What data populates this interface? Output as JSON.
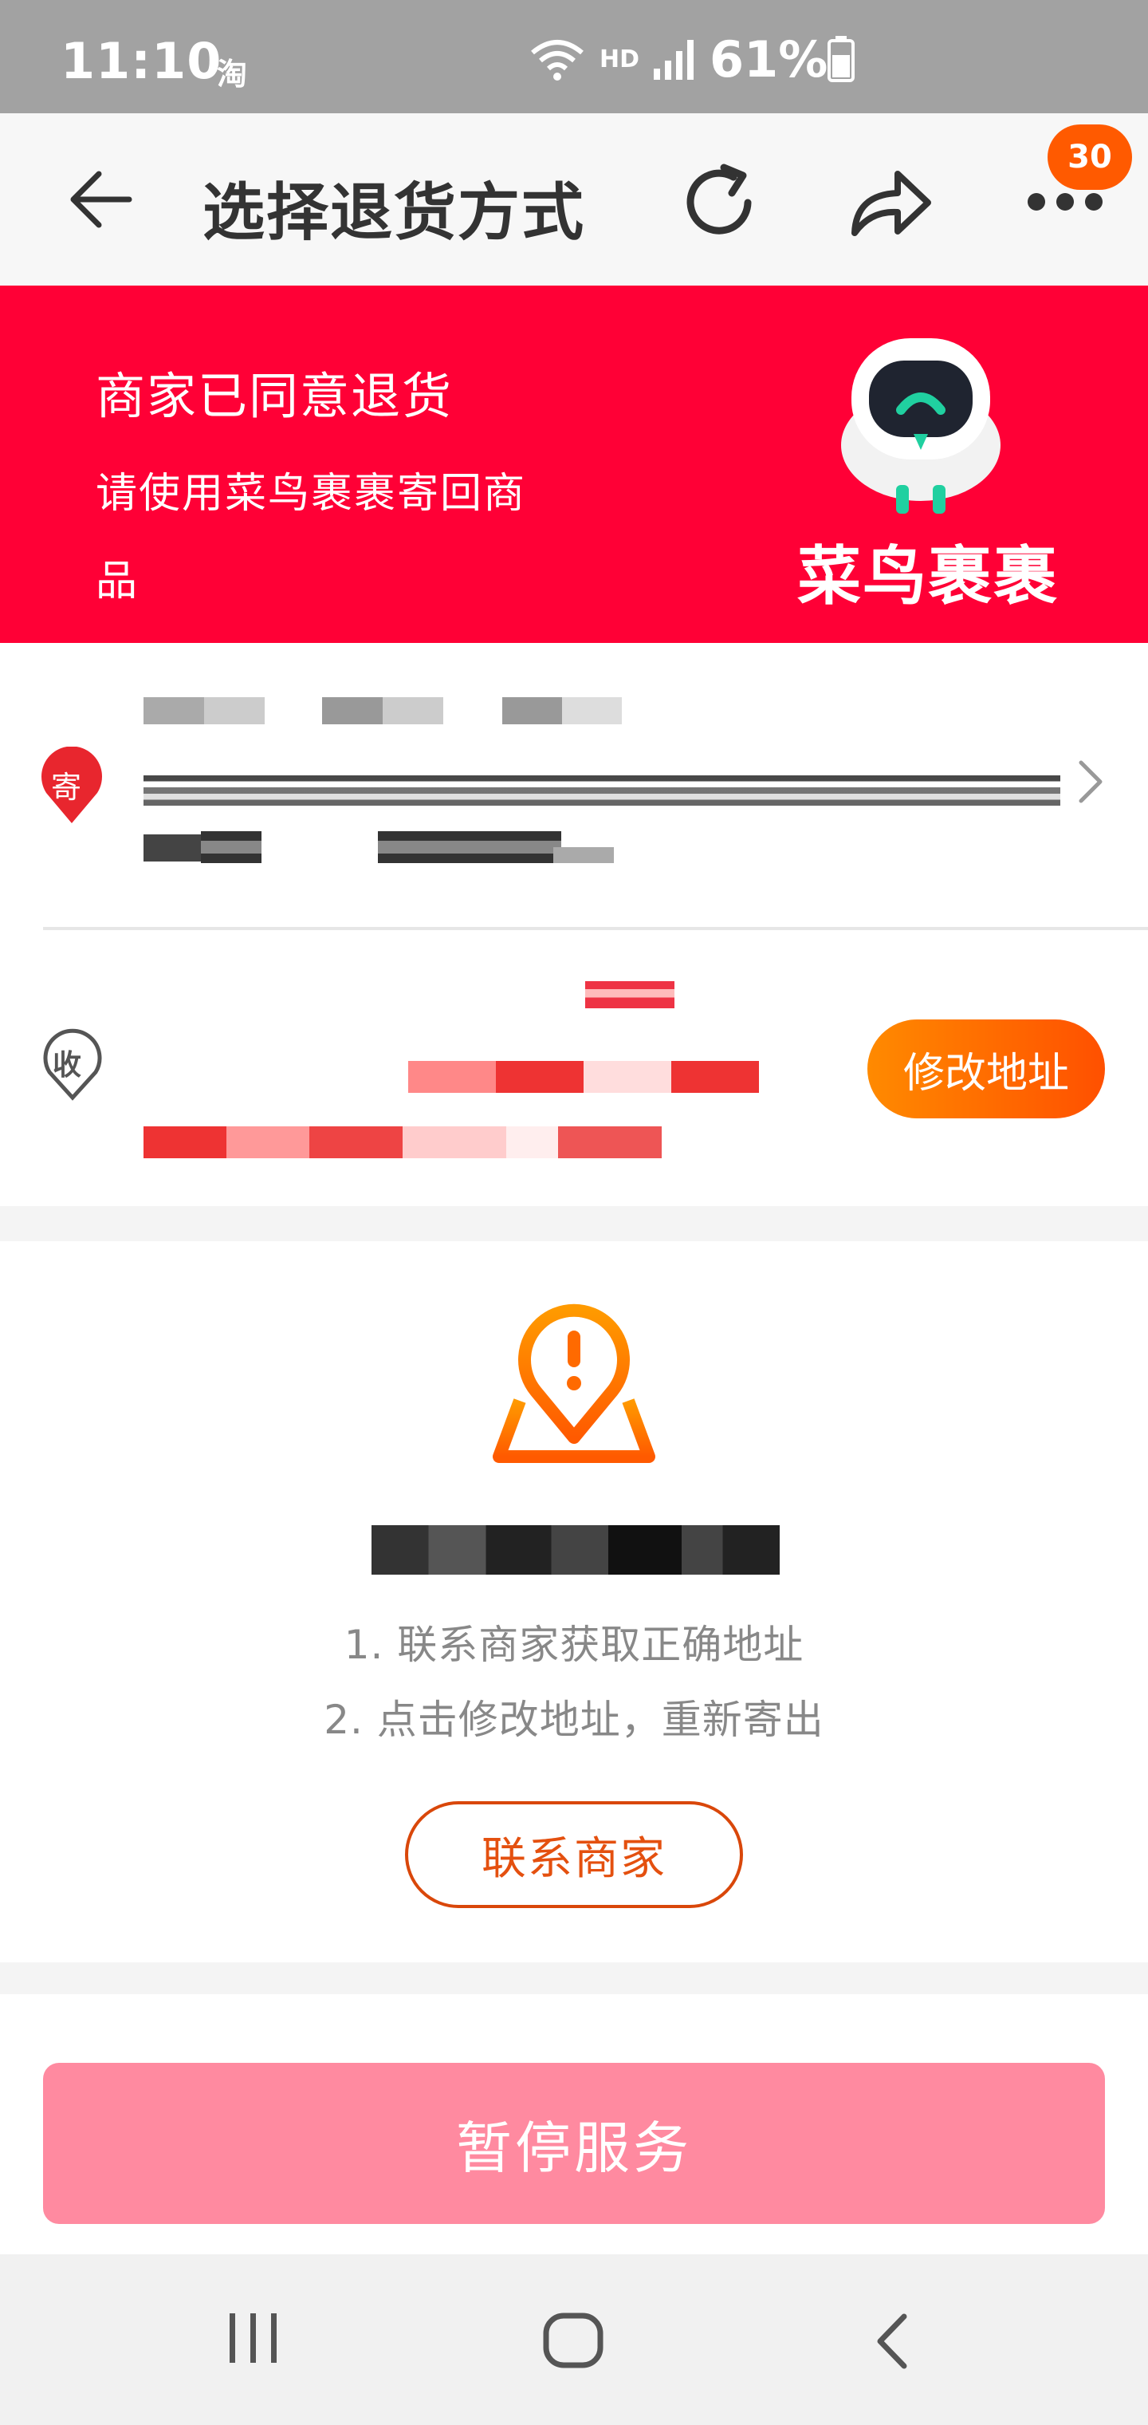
{
  "status_bar": {
    "time": "11:10",
    "app_icon_label": "淘",
    "network": "HD",
    "battery": "61%"
  },
  "header": {
    "title": "选择退货方式",
    "badge_count": "30"
  },
  "banner": {
    "title": "商家已同意退货",
    "subtitle": "请使用菜鸟裹裹寄回商品",
    "brand": "菜鸟裹裹",
    "bg_color": "#ff0036"
  },
  "address": {
    "sender_tag": "寄",
    "receiver_tag": "收",
    "edit_button": "修改地址"
  },
  "notice": {
    "step1": "1. 联系商家获取正确地址",
    "step2": "2. 点击修改地址，重新寄出",
    "contact_button": "联系商家"
  },
  "footer": {
    "pause_button": "暂停服务"
  },
  "icons": {
    "back": "back-arrow-icon",
    "refresh": "refresh-icon",
    "share": "share-icon",
    "more": "more-icon",
    "warning": "location-warning-icon"
  }
}
